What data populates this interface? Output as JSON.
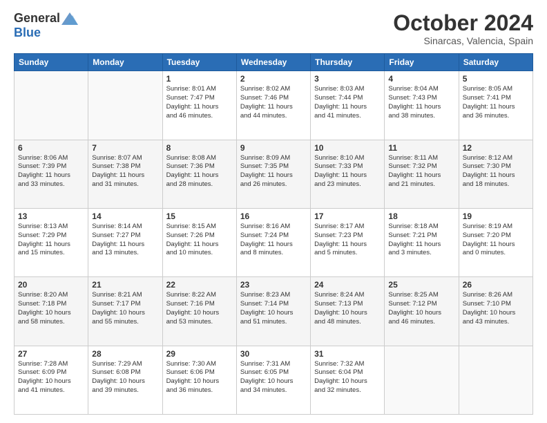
{
  "header": {
    "logo_general": "General",
    "logo_blue": "Blue",
    "month_title": "October 2024",
    "location": "Sinarcas, Valencia, Spain"
  },
  "weekdays": [
    "Sunday",
    "Monday",
    "Tuesday",
    "Wednesday",
    "Thursday",
    "Friday",
    "Saturday"
  ],
  "weeks": [
    {
      "row_class": "row-week1",
      "days": [
        {
          "num": "",
          "empty": true
        },
        {
          "num": "",
          "empty": true
        },
        {
          "num": "1",
          "lines": [
            "Sunrise: 8:01 AM",
            "Sunset: 7:47 PM",
            "Daylight: 11 hours",
            "and 46 minutes."
          ]
        },
        {
          "num": "2",
          "lines": [
            "Sunrise: 8:02 AM",
            "Sunset: 7:46 PM",
            "Daylight: 11 hours",
            "and 44 minutes."
          ]
        },
        {
          "num": "3",
          "lines": [
            "Sunrise: 8:03 AM",
            "Sunset: 7:44 PM",
            "Daylight: 11 hours",
            "and 41 minutes."
          ]
        },
        {
          "num": "4",
          "lines": [
            "Sunrise: 8:04 AM",
            "Sunset: 7:43 PM",
            "Daylight: 11 hours",
            "and 38 minutes."
          ]
        },
        {
          "num": "5",
          "lines": [
            "Sunrise: 8:05 AM",
            "Sunset: 7:41 PM",
            "Daylight: 11 hours",
            "and 36 minutes."
          ]
        }
      ]
    },
    {
      "row_class": "row-week2",
      "days": [
        {
          "num": "6",
          "lines": [
            "Sunrise: 8:06 AM",
            "Sunset: 7:39 PM",
            "Daylight: 11 hours",
            "and 33 minutes."
          ]
        },
        {
          "num": "7",
          "lines": [
            "Sunrise: 8:07 AM",
            "Sunset: 7:38 PM",
            "Daylight: 11 hours",
            "and 31 minutes."
          ]
        },
        {
          "num": "8",
          "lines": [
            "Sunrise: 8:08 AM",
            "Sunset: 7:36 PM",
            "Daylight: 11 hours",
            "and 28 minutes."
          ]
        },
        {
          "num": "9",
          "lines": [
            "Sunrise: 8:09 AM",
            "Sunset: 7:35 PM",
            "Daylight: 11 hours",
            "and 26 minutes."
          ]
        },
        {
          "num": "10",
          "lines": [
            "Sunrise: 8:10 AM",
            "Sunset: 7:33 PM",
            "Daylight: 11 hours",
            "and 23 minutes."
          ]
        },
        {
          "num": "11",
          "lines": [
            "Sunrise: 8:11 AM",
            "Sunset: 7:32 PM",
            "Daylight: 11 hours",
            "and 21 minutes."
          ]
        },
        {
          "num": "12",
          "lines": [
            "Sunrise: 8:12 AM",
            "Sunset: 7:30 PM",
            "Daylight: 11 hours",
            "and 18 minutes."
          ]
        }
      ]
    },
    {
      "row_class": "row-week3",
      "days": [
        {
          "num": "13",
          "lines": [
            "Sunrise: 8:13 AM",
            "Sunset: 7:29 PM",
            "Daylight: 11 hours",
            "and 15 minutes."
          ]
        },
        {
          "num": "14",
          "lines": [
            "Sunrise: 8:14 AM",
            "Sunset: 7:27 PM",
            "Daylight: 11 hours",
            "and 13 minutes."
          ]
        },
        {
          "num": "15",
          "lines": [
            "Sunrise: 8:15 AM",
            "Sunset: 7:26 PM",
            "Daylight: 11 hours",
            "and 10 minutes."
          ]
        },
        {
          "num": "16",
          "lines": [
            "Sunrise: 8:16 AM",
            "Sunset: 7:24 PM",
            "Daylight: 11 hours",
            "and 8 minutes."
          ]
        },
        {
          "num": "17",
          "lines": [
            "Sunrise: 8:17 AM",
            "Sunset: 7:23 PM",
            "Daylight: 11 hours",
            "and 5 minutes."
          ]
        },
        {
          "num": "18",
          "lines": [
            "Sunrise: 8:18 AM",
            "Sunset: 7:21 PM",
            "Daylight: 11 hours",
            "and 3 minutes."
          ]
        },
        {
          "num": "19",
          "lines": [
            "Sunrise: 8:19 AM",
            "Sunset: 7:20 PM",
            "Daylight: 11 hours",
            "and 0 minutes."
          ]
        }
      ]
    },
    {
      "row_class": "row-week4",
      "days": [
        {
          "num": "20",
          "lines": [
            "Sunrise: 8:20 AM",
            "Sunset: 7:18 PM",
            "Daylight: 10 hours",
            "and 58 minutes."
          ]
        },
        {
          "num": "21",
          "lines": [
            "Sunrise: 8:21 AM",
            "Sunset: 7:17 PM",
            "Daylight: 10 hours",
            "and 55 minutes."
          ]
        },
        {
          "num": "22",
          "lines": [
            "Sunrise: 8:22 AM",
            "Sunset: 7:16 PM",
            "Daylight: 10 hours",
            "and 53 minutes."
          ]
        },
        {
          "num": "23",
          "lines": [
            "Sunrise: 8:23 AM",
            "Sunset: 7:14 PM",
            "Daylight: 10 hours",
            "and 51 minutes."
          ]
        },
        {
          "num": "24",
          "lines": [
            "Sunrise: 8:24 AM",
            "Sunset: 7:13 PM",
            "Daylight: 10 hours",
            "and 48 minutes."
          ]
        },
        {
          "num": "25",
          "lines": [
            "Sunrise: 8:25 AM",
            "Sunset: 7:12 PM",
            "Daylight: 10 hours",
            "and 46 minutes."
          ]
        },
        {
          "num": "26",
          "lines": [
            "Sunrise: 8:26 AM",
            "Sunset: 7:10 PM",
            "Daylight: 10 hours",
            "and 43 minutes."
          ]
        }
      ]
    },
    {
      "row_class": "row-week5",
      "days": [
        {
          "num": "27",
          "lines": [
            "Sunrise: 7:28 AM",
            "Sunset: 6:09 PM",
            "Daylight: 10 hours",
            "and 41 minutes."
          ]
        },
        {
          "num": "28",
          "lines": [
            "Sunrise: 7:29 AM",
            "Sunset: 6:08 PM",
            "Daylight: 10 hours",
            "and 39 minutes."
          ]
        },
        {
          "num": "29",
          "lines": [
            "Sunrise: 7:30 AM",
            "Sunset: 6:06 PM",
            "Daylight: 10 hours",
            "and 36 minutes."
          ]
        },
        {
          "num": "30",
          "lines": [
            "Sunrise: 7:31 AM",
            "Sunset: 6:05 PM",
            "Daylight: 10 hours",
            "and 34 minutes."
          ]
        },
        {
          "num": "31",
          "lines": [
            "Sunrise: 7:32 AM",
            "Sunset: 6:04 PM",
            "Daylight: 10 hours",
            "and 32 minutes."
          ]
        },
        {
          "num": "",
          "empty": true
        },
        {
          "num": "",
          "empty": true
        }
      ]
    }
  ]
}
